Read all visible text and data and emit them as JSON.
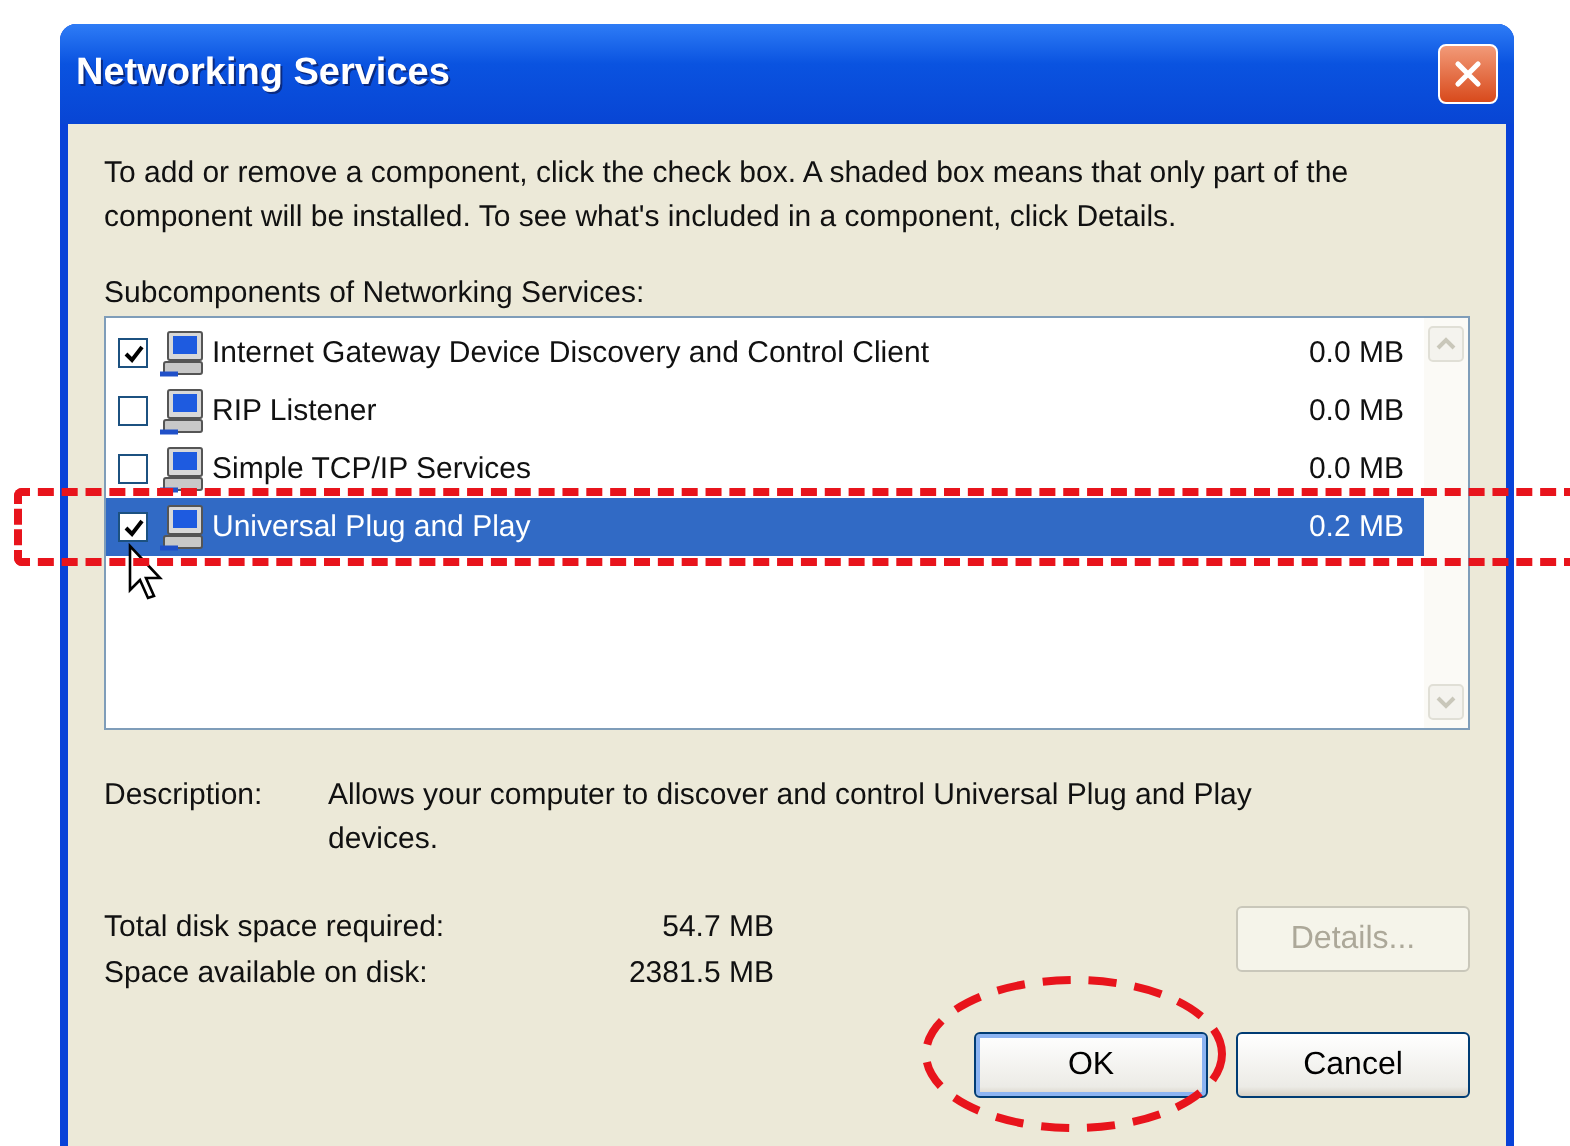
{
  "window": {
    "title": "Networking Services"
  },
  "intro": "To add or remove a component, click the check box. A shaded box means that only part of the component will be installed. To see what's included in a component, click Details.",
  "list_label": "Subcomponents of Networking Services:",
  "components": [
    {
      "name": "Internet Gateway Device Discovery and Control Client",
      "size": "0.0 MB",
      "checked": true,
      "selected": false,
      "highlighted": false
    },
    {
      "name": "RIP Listener",
      "size": "0.0 MB",
      "checked": false,
      "selected": false,
      "highlighted": false
    },
    {
      "name": "Simple TCP/IP Services",
      "size": "0.0 MB",
      "checked": false,
      "selected": false,
      "highlighted": false
    },
    {
      "name": "Universal Plug and Play",
      "size": "0.2 MB",
      "checked": true,
      "selected": true,
      "highlighted": true
    }
  ],
  "description": {
    "label": "Description:",
    "text": "Allows your computer to discover and control Universal Plug and Play devices."
  },
  "disk": [
    {
      "label": "Total disk space required:",
      "value": "54.7 MB"
    },
    {
      "label": "Space available on disk:",
      "value": "2381.5 MB"
    }
  ],
  "details_button": {
    "label": "Details...",
    "disabled": true
  },
  "buttons": [
    {
      "label": "OK",
      "default": true,
      "circled": true
    },
    {
      "label": "Cancel",
      "default": false,
      "circled": false
    }
  ]
}
